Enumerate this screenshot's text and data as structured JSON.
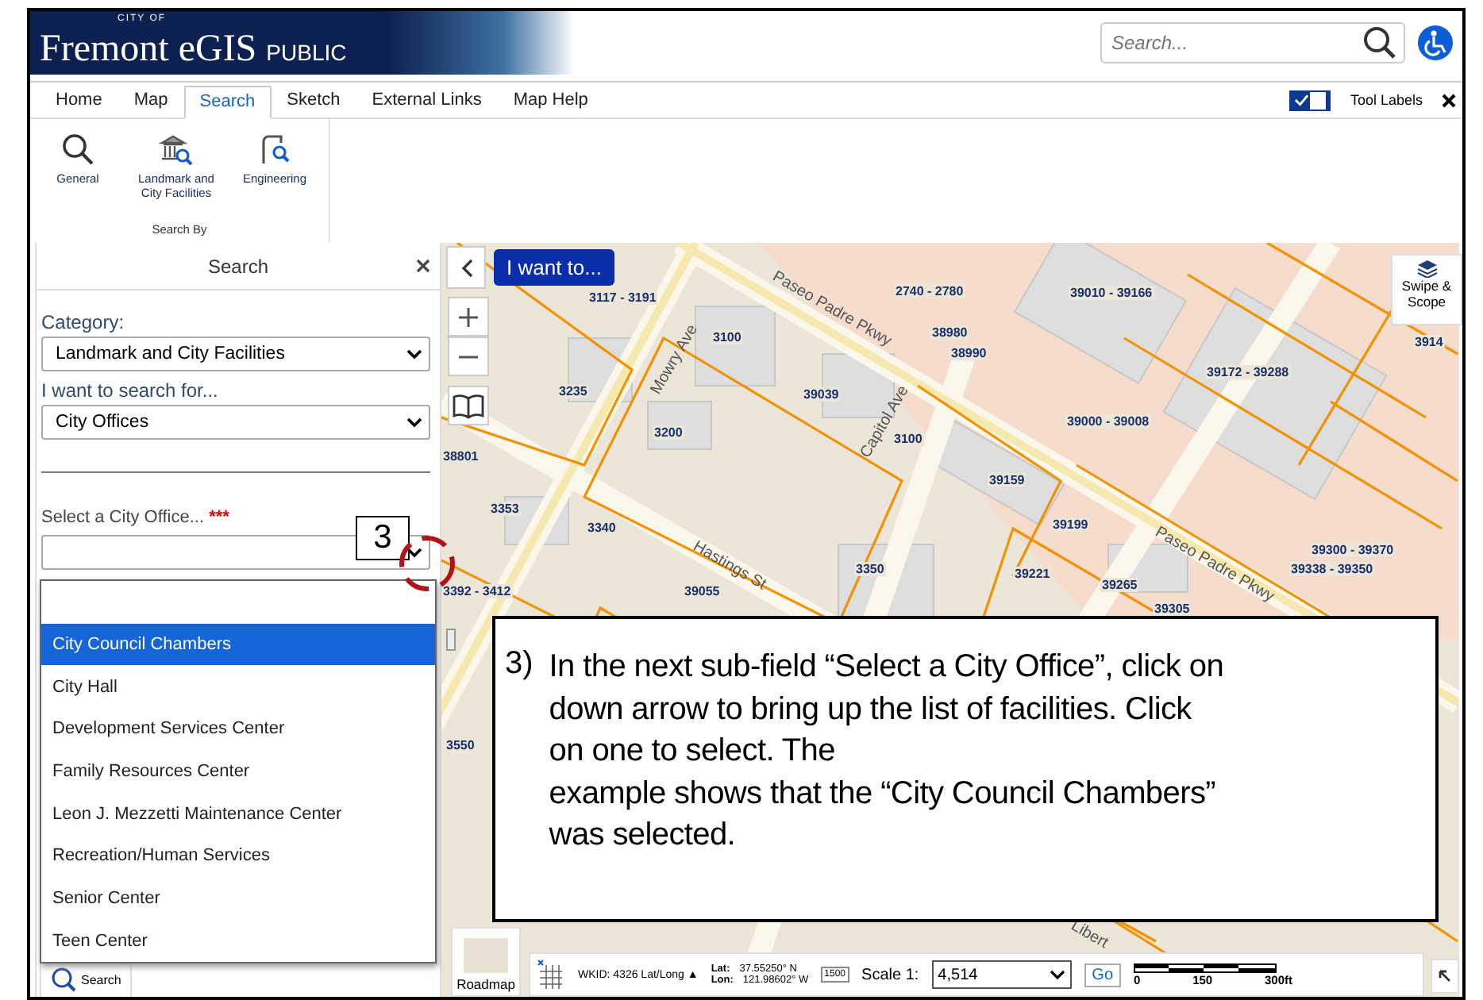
{
  "header": {
    "logo_small": "CITY OF",
    "logo": "Fremont eGIS",
    "logo_suffix": "PUBLIC",
    "search": {
      "placeholder": "Search..."
    }
  },
  "tabs": [
    {
      "label": "Home",
      "selected": false
    },
    {
      "label": "Map",
      "selected": false
    },
    {
      "label": "Search",
      "selected": true
    },
    {
      "label": "Sketch",
      "selected": false
    },
    {
      "label": "External Links",
      "selected": false
    },
    {
      "label": "Map Help",
      "selected": false
    }
  ],
  "tool_labels": {
    "label": "Tool Labels",
    "checked": true
  },
  "ribbon": {
    "group_label": "Search By",
    "buttons": [
      {
        "label": "General",
        "kind": "magnifier"
      },
      {
        "label": "Landmark and City Facilities",
        "kind": "landmark"
      },
      {
        "label": "Engineering",
        "kind": "engineering"
      }
    ]
  },
  "search_panel": {
    "title": "Search",
    "fields": [
      {
        "label": "Category:",
        "value": "Landmark and City Facilities"
      },
      {
        "label": "I want to search for...",
        "value": "City Offices"
      }
    ],
    "office_label": "Select a City Office...",
    "required_mark": "***",
    "options": [
      {
        "label": "City Council Chambers",
        "selected": true
      },
      {
        "label": "City Hall",
        "selected": false
      },
      {
        "label": "Development Services Center",
        "selected": false
      },
      {
        "label": "Family Resources Center",
        "selected": false
      },
      {
        "label": "Leon J. Mezzetti Maintenance Center",
        "selected": false
      },
      {
        "label": "Recreation/Human Services",
        "selected": false
      },
      {
        "label": "Senior Center",
        "selected": false
      },
      {
        "label": "Teen Center",
        "selected": false
      }
    ]
  },
  "map": {
    "i_want_to": "I want to...",
    "swipe_scope": "Swipe & Scope",
    "parcel_labels": [
      "3117 - 3191",
      "2740 - 2780",
      "39010 - 39166",
      "38980",
      "38990",
      "3100",
      "39172 - 39288",
      "3914",
      "3235",
      "39039",
      "39000 - 39008",
      "3200",
      "3100",
      "38801",
      "39159",
      "3353",
      "3340",
      "39199",
      "3350",
      "39221",
      "39265",
      "39300 - 39370",
      "39338 - 39350",
      "3392 - 3412",
      "39055",
      "39305",
      "3550"
    ],
    "street_labels": [
      "Mowry Ave",
      "Paseo Padre Pkwy",
      "Capitol Ave",
      "Hastings St",
      "Paseo Padre Pkwy",
      "Libert"
    ]
  },
  "bottom": {
    "search_button": "Search",
    "basemap_label": "Roadmap",
    "wkid": "WKID: 4326 Lat/Long ▲",
    "lat_label": "Lat:",
    "lat": "37.55250° N",
    "lon_label": "Lon:",
    "lon": "121.98602° W",
    "scale_icon": "1500",
    "scale_label": "Scale 1:",
    "scale_value": "4,514",
    "go": "Go",
    "scalebar_ticks": [
      "0",
      "150",
      "300ft"
    ]
  },
  "annotation": {
    "step": "3",
    "number": "3)",
    "lines": [
      "In the next sub-field “Select a City Office”, click on",
      "down arrow to bring up the list of facilities.  Click",
      "on one to select.  The",
      "example shows that  the “City Council Chambers”",
      "was selected."
    ]
  }
}
